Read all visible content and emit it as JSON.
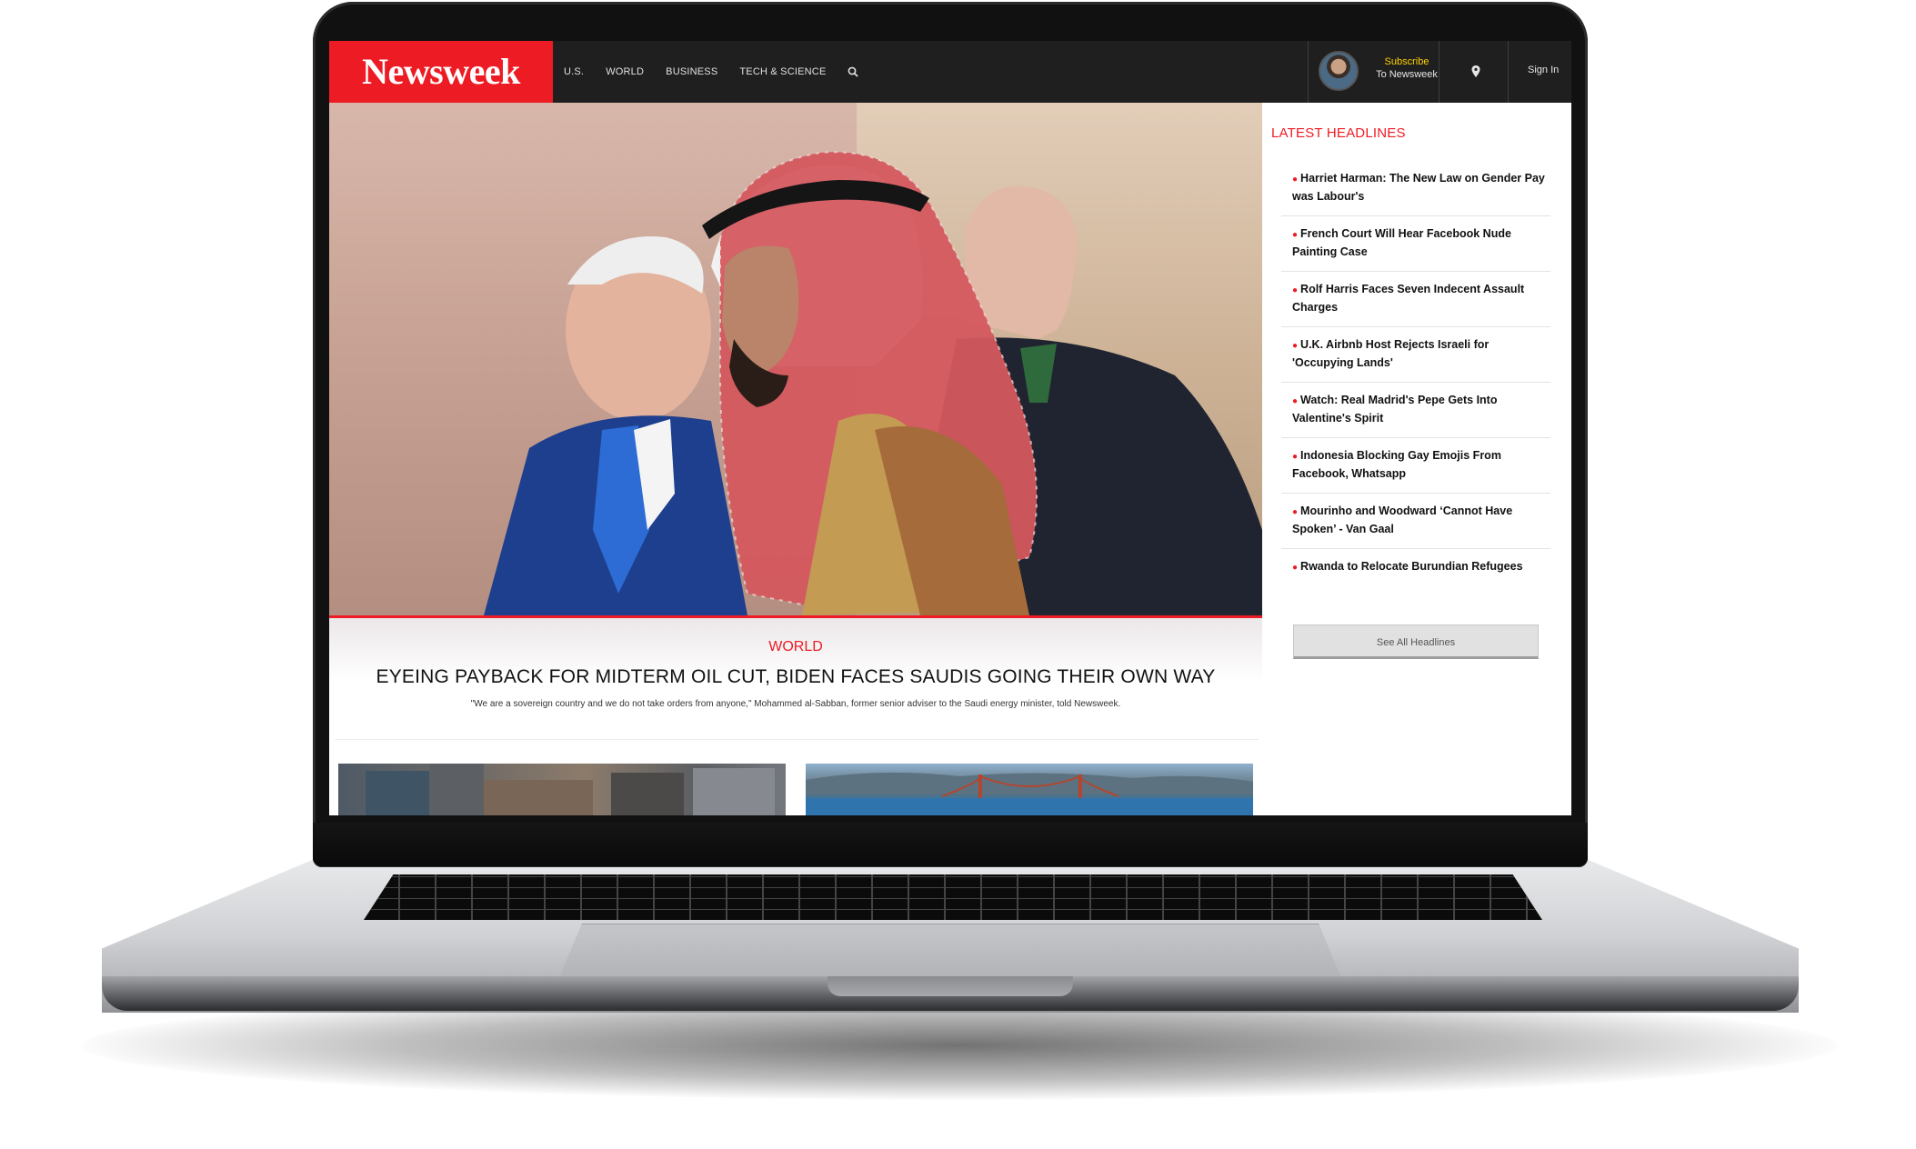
{
  "brand": {
    "name": "Newsweek",
    "accent": "#ed1c24",
    "nav_bg": "#1f1f1f",
    "subscribe_color": "#ffd100"
  },
  "nav": {
    "items": [
      "U.S.",
      "WORLD",
      "BUSINESS",
      "TECH & SCIENCE"
    ],
    "search_icon": "search-icon"
  },
  "account": {
    "subscribe": "Subscribe",
    "to_newsweek": "To Newsweek",
    "location_icon": "map-pin-icon",
    "sign_in": "Sign In"
  },
  "hero": {
    "section": "WORLD",
    "headline": "EYEING PAYBACK FOR MIDTERM OIL CUT, BIDEN FACES SAUDIS GOING THEIR OWN WAY",
    "dek": "\"We are a sovereign country and we do not take orders from anyone,\" Mohammed al-Sabban, former senior adviser to the Saudi energy minister, told Newsweek."
  },
  "sidebar": {
    "title": "LATEST HEADLINES",
    "items": [
      "Harriet Harman: The New Law on Gender Pay was Labour's",
      "French Court Will Hear Facebook Nude Painting Case",
      "Rolf Harris Faces Seven Indecent Assault Charges",
      "U.K. Airbnb Host Rejects Israeli for 'Occupying Lands'",
      "Watch: Real Madrid's Pepe Gets Into Valentine's Spirit",
      "Indonesia Blocking Gay Emojis From Facebook, Whatsapp",
      "Mourinho and Woodward ‘Cannot Have Spoken’ - Van Gaal",
      "Rwanda to Relocate Burundian Refugees"
    ],
    "see_all": "See All Headlines"
  }
}
